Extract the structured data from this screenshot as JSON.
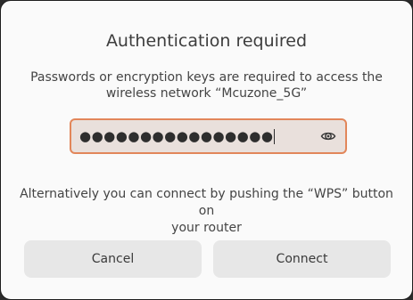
{
  "dialog": {
    "title": "Authentication required",
    "message_line1": "Passwords or encryption keys are required to access the",
    "message_line2": "wireless network “Mcuzone_5G”",
    "password": {
      "masked_value": "●●●●●●●●●●●●●●●●",
      "reveal_icon": "eye-icon",
      "focus_color": "#e2865a"
    },
    "alt_line1": "Alternatively you can connect by pushing the “WPS” button on",
    "alt_line2": "your router",
    "buttons": {
      "cancel": "Cancel",
      "connect": "Connect"
    }
  }
}
